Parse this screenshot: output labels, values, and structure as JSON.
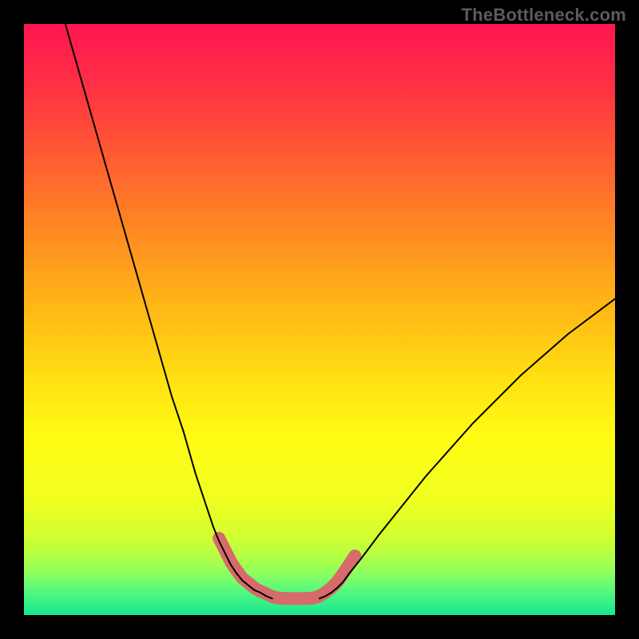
{
  "watermark": "TheBottleneck.com",
  "chart_data": {
    "type": "line",
    "title": "",
    "xlabel": "",
    "ylabel": "",
    "xlim": [
      0,
      100
    ],
    "ylim": [
      0,
      100
    ],
    "grid": false,
    "legend": false,
    "curve_left": {
      "x": [
        7,
        9,
        11,
        13,
        15,
        17,
        19,
        21,
        23,
        25,
        27,
        29,
        30,
        31,
        32,
        33,
        34,
        35,
        36,
        37,
        38,
        39,
        40,
        41,
        42
      ],
      "y": [
        100,
        93,
        86,
        79,
        72,
        65,
        58,
        51,
        44,
        37,
        31,
        24,
        21,
        18,
        15,
        12.5,
        10.5,
        8.5,
        7,
        5.8,
        5,
        4.2,
        3.8,
        3.2,
        2.8
      ]
    },
    "curve_right": {
      "x": [
        50,
        51,
        52,
        53,
        54,
        55,
        57,
        60,
        64,
        68,
        72,
        76,
        80,
        84,
        88,
        92,
        96,
        100
      ],
      "y": [
        2.8,
        3.2,
        3.8,
        4.6,
        5.6,
        7,
        9.5,
        13.5,
        18.5,
        23.5,
        28,
        32.5,
        36.5,
        40.5,
        44,
        47.5,
        50.5,
        53.5
      ]
    },
    "highlight_band": {
      "x": [
        33,
        34,
        35,
        36,
        37,
        38,
        39,
        40,
        41,
        42,
        43,
        44,
        45,
        46,
        47,
        48,
        49,
        50,
        51,
        52,
        53,
        54,
        55,
        56
      ],
      "y": [
        13,
        11,
        9,
        7.5,
        6.2,
        5.4,
        4.6,
        4,
        3.6,
        3.1,
        2.9,
        2.8,
        2.8,
        2.8,
        2.8,
        2.8,
        2.9,
        3.2,
        3.8,
        4.6,
        5.6,
        7,
        8.5,
        10
      ],
      "color": "#d76a6a",
      "thickness": 16
    },
    "gradient_stops": [
      {
        "offset": 0.0,
        "color": "#ff1650"
      },
      {
        "offset": 0.1,
        "color": "#ff2f44"
      },
      {
        "offset": 0.22,
        "color": "#ff5a33"
      },
      {
        "offset": 0.35,
        "color": "#ff8a22"
      },
      {
        "offset": 0.48,
        "color": "#ffb716"
      },
      {
        "offset": 0.6,
        "color": "#ffe012"
      },
      {
        "offset": 0.7,
        "color": "#fffc14"
      },
      {
        "offset": 0.8,
        "color": "#f1ff1f"
      },
      {
        "offset": 0.86,
        "color": "#d6ff2d"
      },
      {
        "offset": 0.9,
        "color": "#b4ff44"
      },
      {
        "offset": 0.93,
        "color": "#8cff5f"
      },
      {
        "offset": 0.96,
        "color": "#55f87f"
      },
      {
        "offset": 1.0,
        "color": "#15e88f"
      }
    ]
  }
}
